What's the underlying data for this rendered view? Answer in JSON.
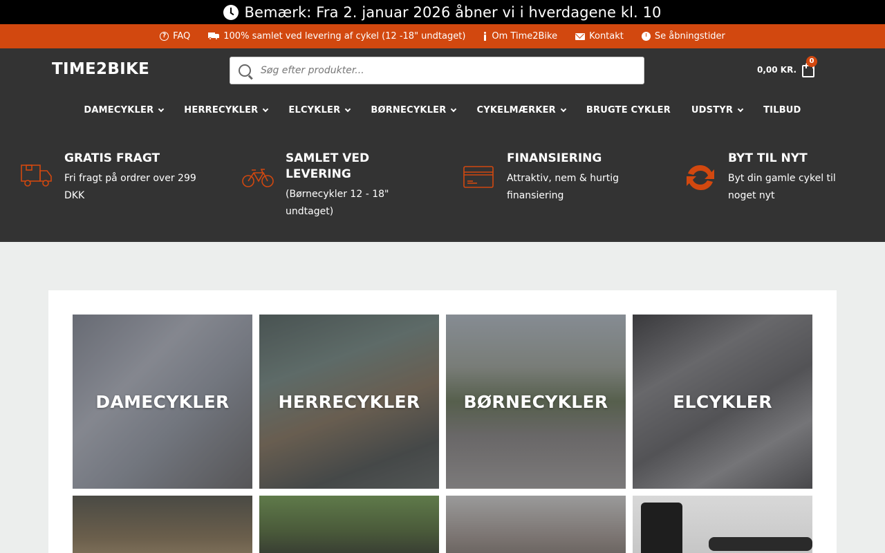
{
  "notice": {
    "text": "Bemærk: Fra 2. januar 2026 åbner vi i hverdagene kl. 10"
  },
  "infobar": {
    "items": [
      {
        "label": "FAQ",
        "icon": "question-circle-icon"
      },
      {
        "label": "100% samlet ved levering af cykel (12 -18\" undtaget)",
        "icon": "truck-icon"
      },
      {
        "label": "Om Time2Bike",
        "icon": "info-icon"
      },
      {
        "label": "Kontakt",
        "icon": "envelope-icon"
      },
      {
        "label": "Se åbningstider",
        "icon": "clock-icon"
      }
    ]
  },
  "header": {
    "logo": "TIME2BIKE",
    "search_placeholder": "Søg efter produkter...",
    "cart_amount": "0,00 KR.",
    "cart_count": "0"
  },
  "nav": {
    "items": [
      {
        "label": "DAMECYKLER",
        "dropdown": true
      },
      {
        "label": "HERRECYKLER",
        "dropdown": true
      },
      {
        "label": "ELCYKLER",
        "dropdown": true
      },
      {
        "label": "BØRNECYKLER",
        "dropdown": true
      },
      {
        "label": "CYKELMÆRKER",
        "dropdown": true
      },
      {
        "label": "BRUGTE CYKLER",
        "dropdown": false
      },
      {
        "label": "UDSTYR",
        "dropdown": true
      },
      {
        "label": "TILBUD",
        "dropdown": false
      }
    ]
  },
  "features": [
    {
      "title": "GRATIS FRAGT",
      "desc": "Fri fragt på ordrer over 299 DKK",
      "icon": "delivery-truck-icon"
    },
    {
      "title": "SAMLET VED LEVERING",
      "desc": "(Børnecykler 12 - 18\" undtaget)",
      "icon": "bicycle-icon"
    },
    {
      "title": "FINANSIERING",
      "desc": "Attraktiv, nem & hurtig finansiering",
      "icon": "credit-card-icon"
    },
    {
      "title": "BYT TIL NYT",
      "desc": "Byt din gamle cykel til noget nyt",
      "icon": "refresh-icon"
    }
  ],
  "categories": [
    {
      "label": "DAMECYKLER"
    },
    {
      "label": "HERRECYKLER"
    },
    {
      "label": "BØRNECYKLER"
    },
    {
      "label": "ELCYKLER"
    }
  ],
  "colors": {
    "accent": "#d2480f",
    "header_bg": "#333333",
    "notice_bg": "#000000",
    "page_bg": "#eceeed"
  }
}
